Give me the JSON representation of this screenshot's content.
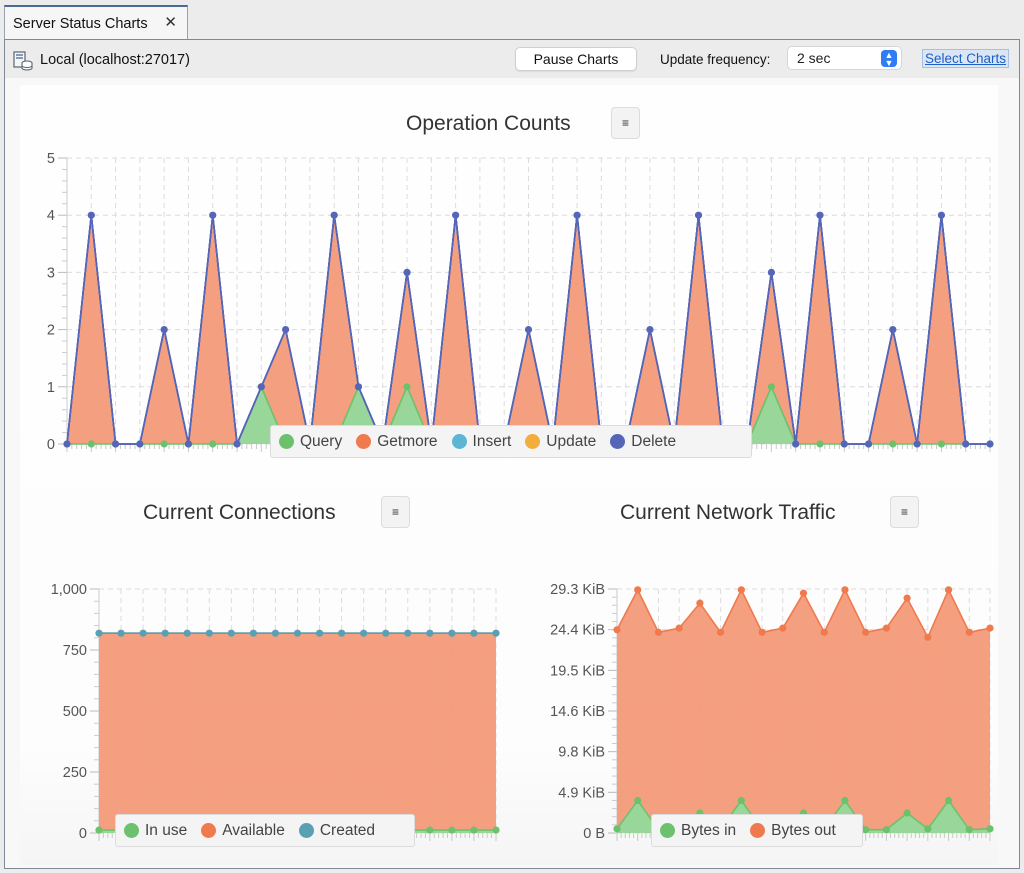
{
  "tab": {
    "title": "Server Status Charts",
    "close_icon": "close-icon"
  },
  "toolbar": {
    "connection_icon": "server-database-icon",
    "connection_label": "Local (localhost:27017)",
    "pause_label": "Pause Charts",
    "frequency_label": "Update frequency:",
    "frequency_value": "2 sec",
    "select_charts_label": "Select Charts"
  },
  "colors": {
    "green": "#6cc26c",
    "green_fill": "#94d494",
    "orange": "#ef7a4d",
    "orange_fill": "#f3a07f",
    "blue": "#5bb5d3",
    "yellow": "#f3ad3c",
    "purple": "#5566b8",
    "teal": "#5b9fb2"
  },
  "chart_data": [
    {
      "id": "operation-counts",
      "type": "area",
      "title": "Operation Counts",
      "menu_icon": "hamburger-menu-icon",
      "stacked": true,
      "ylim": [
        0,
        5
      ],
      "yticks": [
        "0",
        "1",
        "2",
        "3",
        "4",
        "5"
      ],
      "grid": true,
      "legend_position": "bottom",
      "legend": [
        "Query",
        "Getmore",
        "Insert",
        "Update",
        "Delete"
      ],
      "series": [
        {
          "name": "Query",
          "color": "#6cc26c",
          "values": [
            0,
            0,
            0,
            0,
            0,
            0,
            0,
            0,
            1,
            0,
            0,
            0,
            1,
            0,
            1,
            0,
            0,
            0,
            0,
            0,
            0,
            0,
            0,
            0,
            0,
            0,
            0,
            0,
            0,
            1,
            0,
            0,
            0,
            0,
            0,
            0,
            0,
            0,
            0
          ]
        },
        {
          "name": "Getmore",
          "color": "#ef7a4d",
          "values": [
            0,
            4,
            0,
            0,
            2,
            0,
            4,
            0,
            0,
            2,
            0,
            4,
            0,
            0,
            2,
            0,
            4,
            0,
            0,
            2,
            0,
            4,
            0,
            0,
            2,
            0,
            4,
            0,
            0,
            2,
            0,
            4,
            0,
            0,
            2,
            0,
            4,
            0,
            0
          ]
        },
        {
          "name": "Insert",
          "color": "#5bb5d3",
          "values": [
            0,
            0,
            0,
            0,
            0,
            0,
            0,
            0,
            0,
            0,
            0,
            0,
            0,
            0,
            0,
            0,
            0,
            0,
            0,
            0,
            0,
            0,
            0,
            0,
            0,
            0,
            0,
            0,
            0,
            0,
            0,
            0,
            0,
            0,
            0,
            0,
            0,
            0,
            0
          ]
        },
        {
          "name": "Update",
          "color": "#f3ad3c",
          "values": [
            0,
            0,
            0,
            0,
            0,
            0,
            0,
            0,
            0,
            0,
            0,
            0,
            0,
            0,
            0,
            0,
            0,
            0,
            0,
            0,
            0,
            0,
            0,
            0,
            0,
            0,
            0,
            0,
            0,
            0,
            0,
            0,
            0,
            0,
            0,
            0,
            0,
            0,
            0
          ]
        },
        {
          "name": "Delete",
          "color": "#5566b8",
          "values": [
            0,
            0,
            0,
            0,
            0,
            0,
            0,
            0,
            0,
            0,
            0,
            0,
            0,
            0,
            0,
            0,
            0,
            0,
            0,
            0,
            0,
            0,
            0,
            0,
            0,
            0,
            0,
            0,
            0,
            0,
            0,
            0,
            0,
            0,
            0,
            0,
            0,
            0,
            0
          ]
        }
      ]
    },
    {
      "id": "current-connections",
      "type": "area",
      "title": "Current Connections",
      "menu_icon": "hamburger-menu-icon",
      "stacked": true,
      "ylim": [
        0,
        1000
      ],
      "yticks": [
        "0",
        "250",
        "500",
        "750",
        "1,000"
      ],
      "grid": true,
      "legend_position": "bottom",
      "legend": [
        "In use",
        "Available",
        "Created"
      ],
      "series": [
        {
          "name": "In use",
          "color": "#6cc26c",
          "values": [
            12,
            12,
            12,
            12,
            12,
            12,
            12,
            12,
            12,
            12,
            12,
            12,
            12,
            12,
            12,
            12,
            12,
            12,
            12
          ]
        },
        {
          "name": "Available",
          "color": "#ef7a4d",
          "values": [
            807,
            807,
            807,
            807,
            807,
            807,
            807,
            807,
            807,
            807,
            807,
            807,
            807,
            807,
            807,
            807,
            807,
            807,
            807
          ]
        },
        {
          "name": "Created",
          "color": "#5b9fb2",
          "line_only": true,
          "values": [
            819,
            819,
            819,
            819,
            819,
            819,
            819,
            819,
            819,
            819,
            819,
            819,
            819,
            819,
            819,
            819,
            819,
            819,
            819
          ]
        }
      ]
    },
    {
      "id": "current-network-traffic",
      "type": "area",
      "title": "Current Network Traffic",
      "menu_icon": "hamburger-menu-icon",
      "stacked": true,
      "unit": "KiB",
      "ylim": [
        0,
        29.3
      ],
      "yticks": [
        "0 B",
        "4.9 KiB",
        "9.8 KiB",
        "14.6 KiB",
        "19.5 KiB",
        "24.4 KiB",
        "29.3 KiB"
      ],
      "grid": true,
      "legend_position": "bottom",
      "legend": [
        "Bytes in",
        "Bytes out"
      ],
      "series": [
        {
          "name": "Bytes in",
          "color": "#6cc26c",
          "values": [
            0.5,
            3.9,
            0.4,
            0.4,
            2.4,
            0.5,
            3.9,
            0.4,
            0.4,
            2.4,
            0.5,
            3.9,
            0.4,
            0.4,
            2.4,
            0.5,
            3.9,
            0.4,
            0.5
          ]
        },
        {
          "name": "Bytes out",
          "color": "#ef7a4d",
          "values": [
            23.9,
            25.3,
            23.7,
            24.2,
            25.2,
            23.6,
            25.3,
            23.7,
            24.2,
            26.4,
            23.6,
            25.3,
            23.7,
            24.2,
            25.8,
            23.0,
            25.3,
            23.7,
            24.1
          ]
        }
      ]
    }
  ]
}
